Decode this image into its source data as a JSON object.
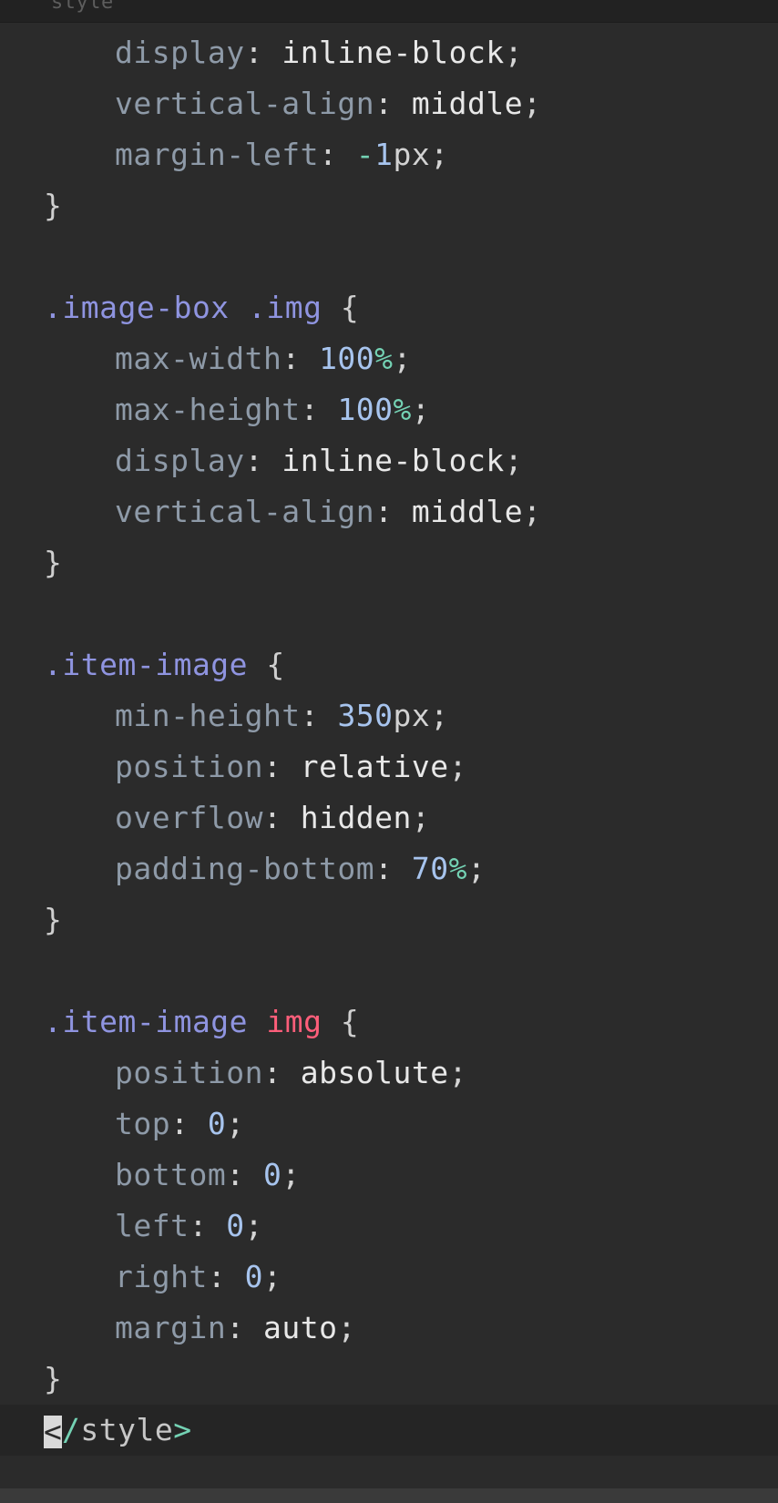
{
  "header": {
    "label": "style"
  },
  "lines": {
    "l1": {
      "prop": "display",
      "value": "inline-block"
    },
    "l2": {
      "prop": "vertical-align",
      "value": "middle"
    },
    "l3": {
      "prop": "margin-left",
      "minus": "-",
      "num": "1",
      "unit": "px"
    },
    "l4": {
      "brace": "}"
    },
    "l6": {
      "sel1": ".image-box",
      "sel2": ".img",
      "brace": "{"
    },
    "l7": {
      "prop": "max-width",
      "num": "100",
      "unit": "%"
    },
    "l8": {
      "prop": "max-height",
      "num": "100",
      "unit": "%"
    },
    "l9": {
      "prop": "display",
      "value": "inline-block"
    },
    "l10": {
      "prop": "vertical-align",
      "value": "middle"
    },
    "l11": {
      "brace": "}"
    },
    "l13": {
      "sel1": ".item-image",
      "brace": "{"
    },
    "l14": {
      "prop": "min-height",
      "num": "350",
      "unit": "px"
    },
    "l15": {
      "prop": "position",
      "value": "relative"
    },
    "l16": {
      "prop": "overflow",
      "value": "hidden"
    },
    "l17": {
      "prop": "padding-bottom",
      "num": "70",
      "unit": "%"
    },
    "l18": {
      "brace": "}"
    },
    "l20": {
      "sel1": ".item-image",
      "tag": "img",
      "brace": "{"
    },
    "l21": {
      "prop": "position",
      "value": "absolute"
    },
    "l22": {
      "prop": "top",
      "num": "0"
    },
    "l23": {
      "prop": "bottom",
      "num": "0"
    },
    "l24": {
      "prop": "left",
      "num": "0"
    },
    "l25": {
      "prop": "right",
      "num": "0"
    },
    "l26": {
      "prop": "margin",
      "value": "auto"
    },
    "l27": {
      "brace": "}"
    },
    "l28": {
      "lt": "<",
      "slash": "/",
      "tagname": "style",
      "gt": ">"
    }
  },
  "punct": {
    "colon": ": ",
    "semi": ";"
  },
  "colors": {
    "background": "#2b2b2b",
    "property": "#8e9aa8",
    "number": "#a7c4ee",
    "unit_accent": "#74d2b4",
    "class_selector": "#8f94e0",
    "tag_selector": "#ff5e7a"
  }
}
